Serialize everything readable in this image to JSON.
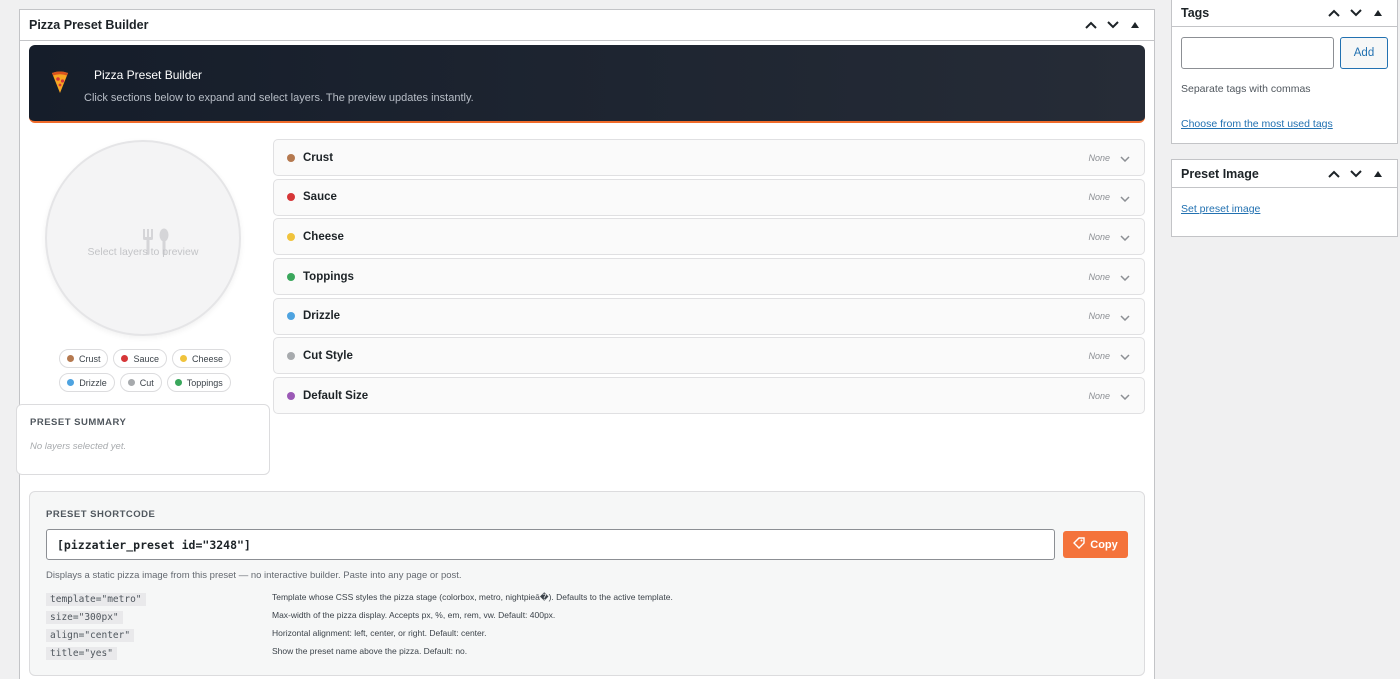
{
  "main_box": {
    "title": "Pizza Preset Builder"
  },
  "banner": {
    "title": "Pizza Preset Builder",
    "subtitle": "Click sections below to expand and select layers. The preview updates instantly."
  },
  "preview": {
    "placeholder": "Select layers to preview"
  },
  "chips": [
    {
      "label": "Crust",
      "color": "#b5794f"
    },
    {
      "label": "Sauce",
      "color": "#d63638"
    },
    {
      "label": "Cheese",
      "color": "#f0c33c"
    },
    {
      "label": "Drizzle",
      "color": "#4ea3e0"
    },
    {
      "label": "Cut",
      "color": "#a7aaad"
    },
    {
      "label": "Toppings",
      "color": "#3aa75c"
    }
  ],
  "summary": {
    "heading": "PRESET SUMMARY",
    "empty": "No layers selected yet."
  },
  "sections": [
    {
      "label": "Crust",
      "value": "None",
      "color": "#b5794f"
    },
    {
      "label": "Sauce",
      "value": "None",
      "color": "#d63638"
    },
    {
      "label": "Cheese",
      "value": "None",
      "color": "#f0c33c"
    },
    {
      "label": "Toppings",
      "value": "None",
      "color": "#3aa75c"
    },
    {
      "label": "Drizzle",
      "value": "None",
      "color": "#4ea3e0"
    },
    {
      "label": "Cut Style",
      "value": "None",
      "color": "#a7aaad"
    },
    {
      "label": "Default Size",
      "value": "None",
      "color": "#9b59b6"
    }
  ],
  "shortcode": {
    "heading": "PRESET SHORTCODE",
    "value": "[pizzatier_preset id=\"3248\"]",
    "copy_label": "Copy",
    "hint": "Displays a static pizza image from this preset — no interactive builder. Paste into any page or post.",
    "params": [
      {
        "code": "template=\"metro\"",
        "desc": "Template whose CSS styles the pizza stage (colorbox, metro, nightpieā�). Defaults to the active template."
      },
      {
        "code": "size=\"300px\"",
        "desc": "Max-width of the pizza display. Accepts px, %, em, rem, vw. Default: 400px."
      },
      {
        "code": "align=\"center\"",
        "desc": "Horizontal alignment: left, center, or right. Default: center."
      },
      {
        "code": "title=\"yes\"",
        "desc": "Show the preset name above the pizza. Default: no."
      }
    ]
  },
  "tags_box": {
    "title": "Tags",
    "input_value": "",
    "add_label": "Add",
    "hint": "Separate tags with commas",
    "link": "Choose from the most used tags"
  },
  "image_box": {
    "title": "Preset Image",
    "link": "Set preset image"
  },
  "accent": "#f06b2a"
}
